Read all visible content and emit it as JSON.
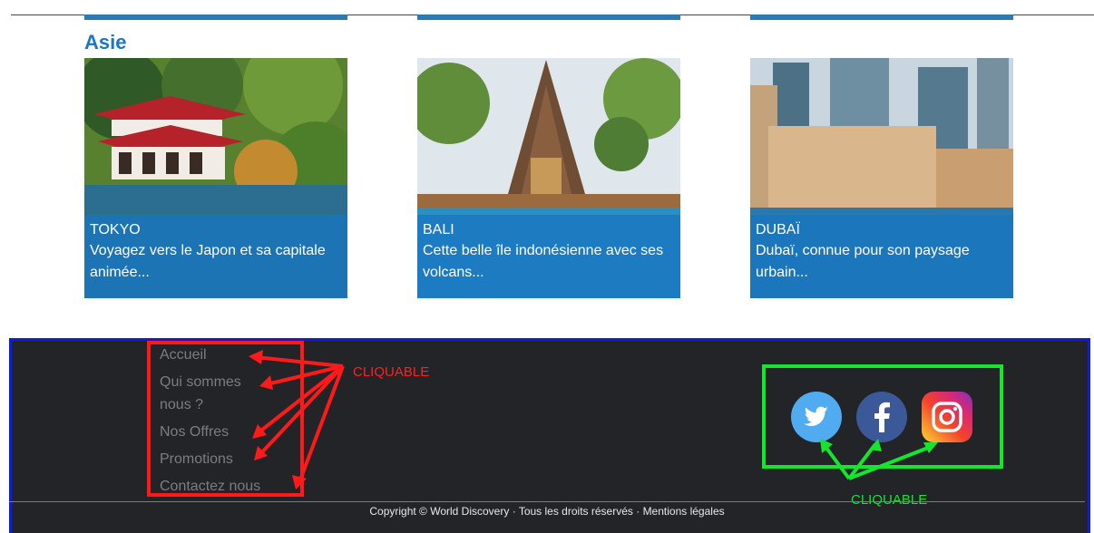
{
  "section": {
    "title": "Asie"
  },
  "destinations": [
    {
      "city": "TOKYO",
      "description": "Voyagez vers le Japon et sa capitale animée..."
    },
    {
      "city": "BALI",
      "description": "Cette belle île indonésienne avec ses volcans..."
    },
    {
      "city": "DUBAÏ",
      "description": "Dubaï, connue pour son paysage urbain..."
    }
  ],
  "footer": {
    "nav": [
      "Accueil",
      "Qui sommes nous ?",
      "Nos Offres",
      "Promotions",
      "Contactez nous"
    ],
    "social": [
      "twitter-icon",
      "facebook-icon",
      "instagram-icon"
    ],
    "copyright": "Copyright © World Discovery",
    "rights": "Tous les droits réservés",
    "legal": "Mentions légales",
    "separator": "·"
  },
  "annotations": {
    "red": "CLIQUABLE",
    "green": "CLIQUABLE"
  },
  "colors": {
    "accent": "#1976c9",
    "footer_bg": "#222428",
    "footer_border": "#0a1ce8",
    "annotation_red": "#ff1a1a",
    "annotation_green": "#14e62e"
  }
}
